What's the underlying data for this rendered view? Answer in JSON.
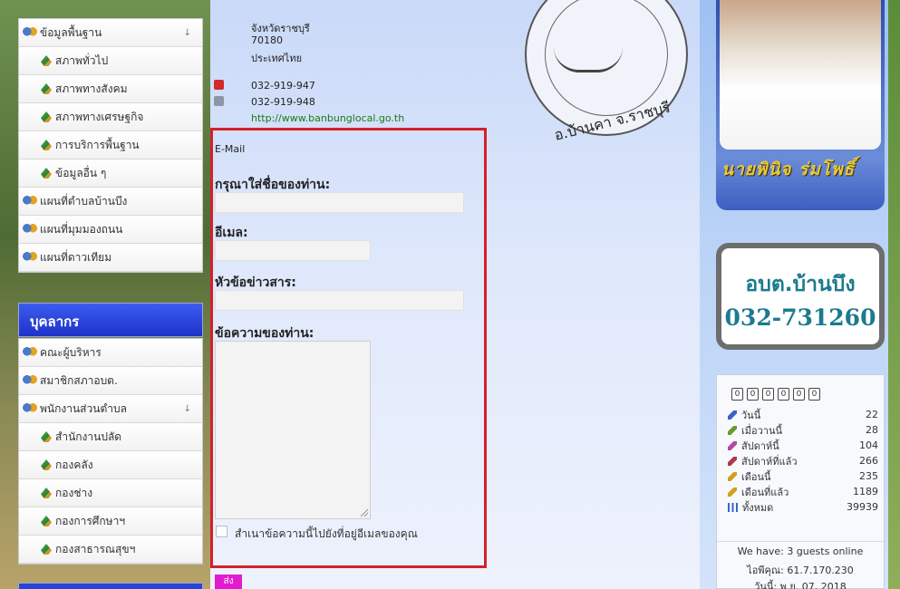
{
  "sidebar": {
    "menu1": [
      {
        "label": "ข้อมูลพื้นฐาน",
        "type": "top",
        "arrow": "↓"
      },
      {
        "label": "สภาพทั่วไป",
        "type": "sub"
      },
      {
        "label": "สภาพทางสังคม",
        "type": "sub"
      },
      {
        "label": "สภาพทางเศรษฐกิจ",
        "type": "sub"
      },
      {
        "label": "การบริการพื้นฐาน",
        "type": "sub"
      },
      {
        "label": "ข้อมูลอื่น ๆ",
        "type": "sub"
      },
      {
        "label": "แผนที่ตำบลบ้านบึง",
        "type": "top"
      },
      {
        "label": "แผนที่มุมมองถนน",
        "type": "top"
      },
      {
        "label": "แผนที่ดาวเทียม",
        "type": "top"
      }
    ],
    "section_title": "บุคลากร",
    "menu2": [
      {
        "label": "คณะผู้บริหาร",
        "type": "top"
      },
      {
        "label": "สมาชิกสภาอบต.",
        "type": "top"
      },
      {
        "label": "พนักงานส่วนตำบล",
        "type": "top",
        "arrow": "↓"
      },
      {
        "label": "สำนักงานปลัด",
        "type": "sub"
      },
      {
        "label": "กองคลัง",
        "type": "sub"
      },
      {
        "label": "กองช่าง",
        "type": "sub"
      },
      {
        "label": "กองการศึกษาฯ",
        "type": "sub"
      },
      {
        "label": "กองสาธารณสุขฯ",
        "type": "sub"
      }
    ]
  },
  "contact": {
    "province": "จังหวัดราชบุรี",
    "postcode": "70180",
    "country": "ประเทศไทย",
    "phone": "032-919-947",
    "fax": "032-919-948",
    "website": "http://www.banbunglocal.go.th",
    "email_label": "E-Mail"
  },
  "form": {
    "name_label": "กรุณาใส่ชื่อของท่าน:",
    "email_label": "อีเมล:",
    "subject_label": "หัวข้อข่าวสาร:",
    "message_label": "ข้อความของท่าน:",
    "copy_label": "สำเนาข้อความนี้ไปยังที่อยู่อีเมลของคุณ",
    "send_label": "ส่ง",
    "name_value": "",
    "email_value": "",
    "subject_value": "",
    "message_value": ""
  },
  "seal": {
    "text": "อ.บ้านคา จ.ราชบุรี"
  },
  "portrait": {
    "name": "นายพินิจ ร่มโพธิ์"
  },
  "card": {
    "title": "อบต.บ้านบึง",
    "phone": "032-731260"
  },
  "stats": {
    "counter_digits": [
      "0",
      "0",
      "0",
      "0",
      "0",
      "0"
    ],
    "rows": [
      {
        "label": "วันนี้",
        "value": "22",
        "icon": "pencil-icon",
        "color": "#3f5fc8"
      },
      {
        "label": "เมื่อวานนี้",
        "value": "28",
        "icon": "pencil-icon",
        "color": "#6a9a2a"
      },
      {
        "label": "สัปดาห์นี้",
        "value": "104",
        "icon": "pencil-icon",
        "color": "#b04aa6"
      },
      {
        "label": "สัปดาห์ที่แล้ว",
        "value": "266",
        "icon": "pencil-icon",
        "color": "#b03a4a"
      },
      {
        "label": "เดือนนี้",
        "value": "235",
        "icon": "pencil-icon",
        "color": "#d0a21a"
      },
      {
        "label": "เดือนที่แล้ว",
        "value": "1189",
        "icon": "pencil-icon",
        "color": "#d0a21a"
      },
      {
        "label": "ทั้งหมด",
        "value": "39939",
        "icon": "bar-chart-icon",
        "color": "#3a66c4"
      }
    ],
    "online": "We have: 3 guests online",
    "ip": "ไอพีคุณ: 61.7.170.230",
    "date": "วันนี้: พ.ย. 07, 2018"
  },
  "colors": {
    "form_border": "#d4202a",
    "section_header": "#2a44d8",
    "send_button": "#e31bd0",
    "card_text": "#1c7a90"
  }
}
